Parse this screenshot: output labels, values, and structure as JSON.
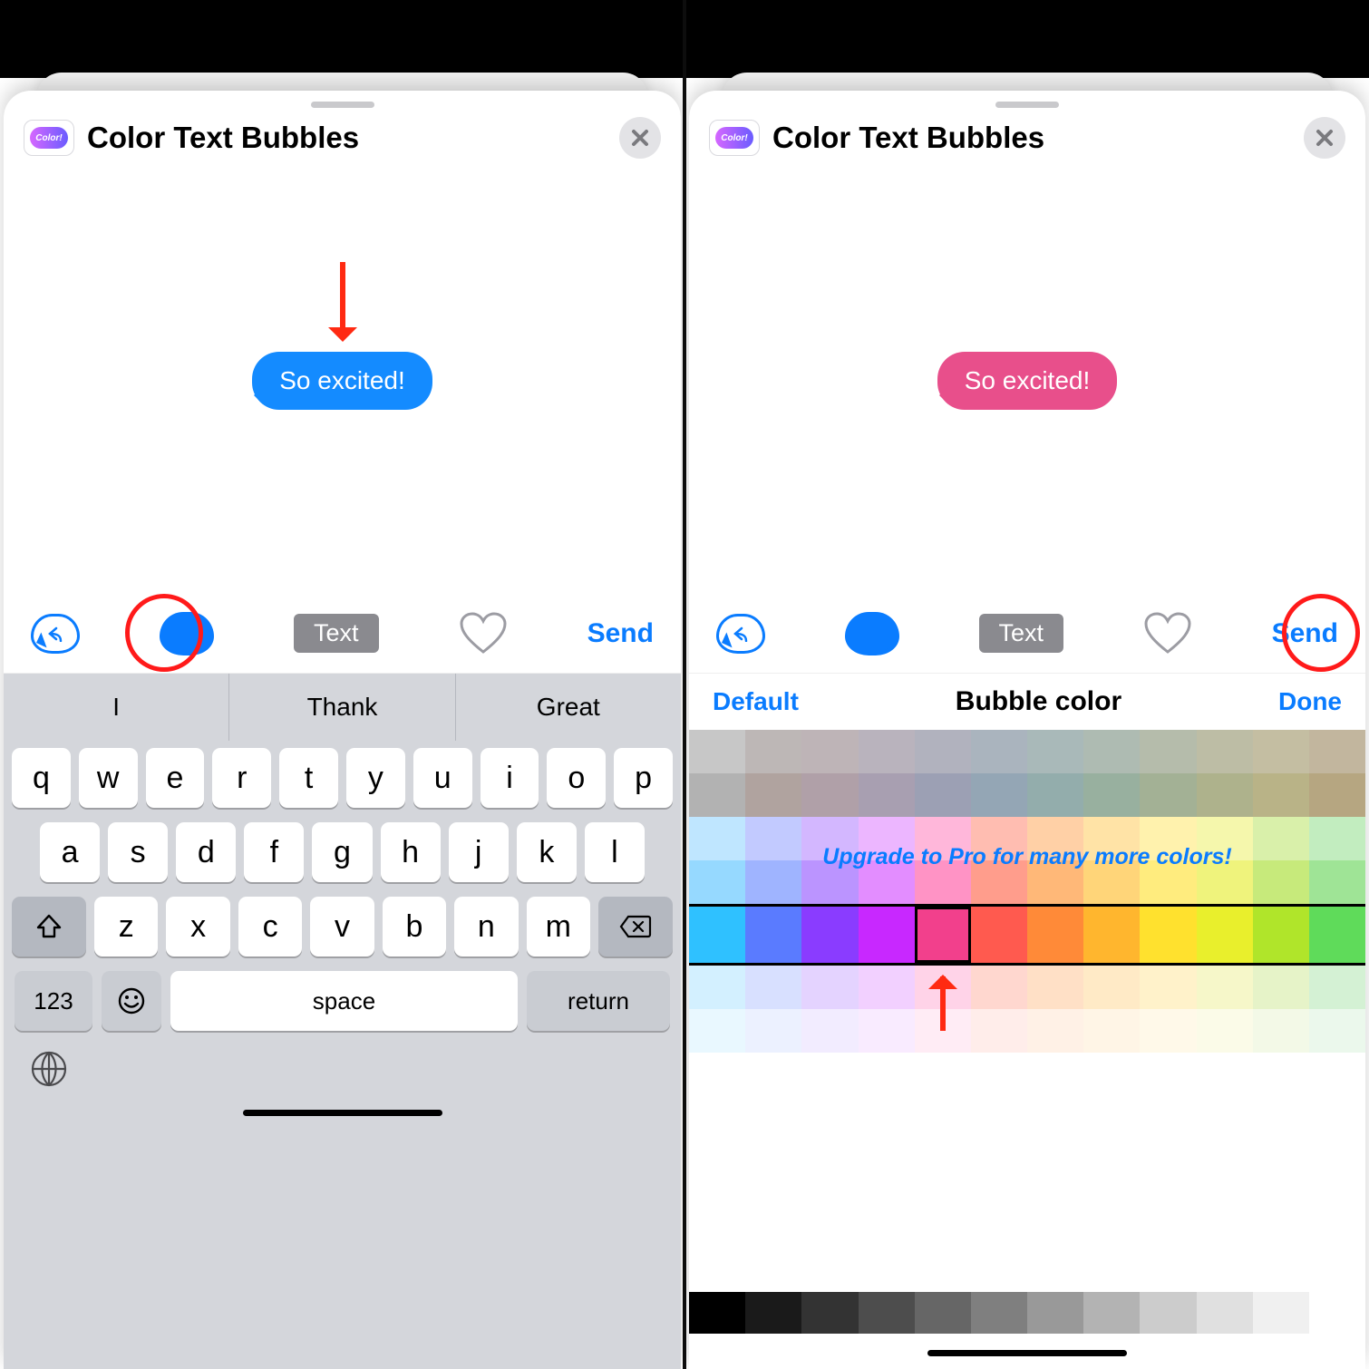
{
  "app": {
    "title": "Color Text Bubbles",
    "icon_text": "Color!"
  },
  "close_label": "✕",
  "preview_text": "So excited!",
  "toolbar": {
    "text_button": "Text",
    "send_label": "Send"
  },
  "keyboard": {
    "suggestions": [
      "I",
      "Thank",
      "Great"
    ],
    "row1": [
      "q",
      "w",
      "e",
      "r",
      "t",
      "y",
      "u",
      "i",
      "o",
      "p"
    ],
    "row2": [
      "a",
      "s",
      "d",
      "f",
      "g",
      "h",
      "j",
      "k",
      "l"
    ],
    "row3": [
      "z",
      "x",
      "c",
      "v",
      "b",
      "n",
      "m"
    ],
    "shift": "⇧",
    "backspace": "⌫",
    "numbers": "123",
    "emoji": "☺",
    "space": "space",
    "return": "return",
    "globe": "🌐"
  },
  "picker": {
    "left": "Default",
    "title": "Bubble color",
    "right": "Done",
    "upgrade": "Upgrade to Pro for many more colors!",
    "muted_rows": [
      [
        "#c7c7c7",
        "#bdb7b6",
        "#beb4b7",
        "#b9b3bd",
        "#b1b2be",
        "#aab4be",
        "#a9b9b9",
        "#aebbb2",
        "#b5bcab",
        "#bdbda5",
        "#c4bea2",
        "#c2b69e"
      ],
      [
        "#b2b2b2",
        "#b0a39f",
        "#b0a0a8",
        "#a89fb1",
        "#9ca0b4",
        "#94a6b5",
        "#93adac",
        "#98b09f",
        "#a3b195",
        "#aeb28c",
        "#b9b387",
        "#b6a681"
      ]
    ],
    "pastel_rows": [
      [
        "#bfe6ff",
        "#c2caff",
        "#d3b7ff",
        "#ecb6ff",
        "#ffb7da",
        "#ffbdb1",
        "#ffd0a6",
        "#ffe3a6",
        "#fff2ad",
        "#f5f7ac",
        "#d9f0aa",
        "#c2edbf"
      ],
      [
        "#96d9ff",
        "#9fb4ff",
        "#bb94ff",
        "#e38dff",
        "#ff93c5",
        "#ff9d8c",
        "#ffb878",
        "#ffd579",
        "#ffec7e",
        "#eff37c",
        "#c7ea7b",
        "#9fe496"
      ]
    ],
    "vivid_row": [
      "#2fc1ff",
      "#5a7bff",
      "#8a3cff",
      "#c828ff",
      "#f2408c",
      "#ff5a4f",
      "#ff8a38",
      "#ffb62e",
      "#ffe12e",
      "#e9ef2c",
      "#b0e52a",
      "#5fdb5a"
    ],
    "selected_vivid_index": 4,
    "pale_rows": [
      [
        "#d3f0ff",
        "#d8e0ff",
        "#e4d3ff",
        "#f2d0ff",
        "#ffd3e8",
        "#ffd7cf",
        "#ffe0c6",
        "#ffeac6",
        "#fff2ca",
        "#f6f7c9",
        "#e6f3c8",
        "#d4f1d4"
      ],
      [
        "#e9f8ff",
        "#ecf1ff",
        "#f2ecff",
        "#f9ebff",
        "#ffecf5",
        "#ffedea",
        "#fff1e6",
        "#fff5e6",
        "#fff9e9",
        "#fbfbe8",
        "#f3f9e7",
        "#ebf8ec"
      ]
    ],
    "gray_row": [
      "#000000",
      "#1a1a1a",
      "#333333",
      "#4d4d4d",
      "#666666",
      "#7f7f7f",
      "#999999",
      "#b3b3b3",
      "#cccccc",
      "#e0e0e0",
      "#f0f0f0",
      "#ffffff"
    ]
  }
}
